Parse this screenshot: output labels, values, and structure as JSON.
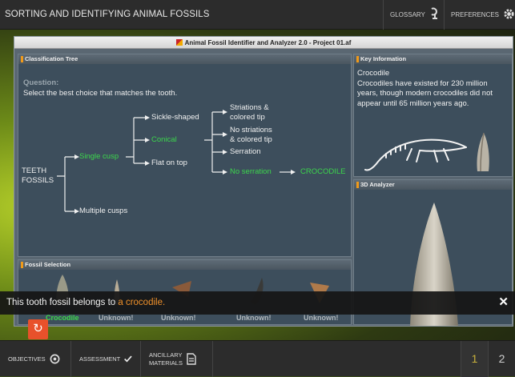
{
  "header": {
    "title": "SORTING AND IDENTIFYING ANIMAL FOSSILS",
    "glossary_label": "GLOSSARY",
    "preferences_label": "PREFERENCES"
  },
  "window": {
    "title": "Animal Fossil Identifier and Analyzer 2.0 - Project 01.af"
  },
  "classification": {
    "heading": "Classification Tree",
    "question_label": "Question:",
    "question_text": "Select the best choice that matches the tooth.",
    "root": "TEETH\nFOSSILS",
    "root_line1": "TEETH",
    "root_line2": "FOSSILS",
    "single_cusp": "Single cusp",
    "multiple_cusps": "Multiple cusps",
    "sickle": "Sickle-shaped",
    "conical": "Conical",
    "flat": "Flat on top",
    "striations_1": "Striations &",
    "striations_2": "colored tip",
    "no_striations_1": "No striations",
    "no_striations_2": "& colored tip",
    "serration": "Serration",
    "no_serration": "No serration",
    "result": "CROCODILE"
  },
  "key_info": {
    "heading": "Key Information",
    "name": "Crocodile",
    "description": "Crocodiles have existed for 230 million years, though modern crocodiles did not appear until 65 million years ago."
  },
  "analyzer": {
    "heading": "3D Analyzer"
  },
  "fossil_selection": {
    "heading": "Fossil Selection",
    "items": [
      {
        "label": "Crocodile"
      },
      {
        "label": "Unknown!"
      },
      {
        "label": "Unknown!"
      },
      {
        "label": "Unknown!"
      },
      {
        "label": "Unknown!"
      }
    ]
  },
  "banner": {
    "prefix": "This tooth fossil belongs to ",
    "highlight": "a crocodile."
  },
  "footer": {
    "objectives": "OBJECTIVES",
    "assessment": "ASSESSMENT",
    "ancillary_1": "ANCILLARY",
    "ancillary_2": "MATERIALS",
    "page_1": "1",
    "page_2": "2"
  },
  "colors": {
    "accent_green": "#3cd64c",
    "accent_orange": "#f0912a",
    "reset_button": "#e8512b",
    "active_page": "#c9b23c"
  },
  "icons": [
    "glossary-icon",
    "gear-icon",
    "close-icon",
    "reset-icon",
    "target-icon",
    "checkmark-icon",
    "document-icon"
  ]
}
